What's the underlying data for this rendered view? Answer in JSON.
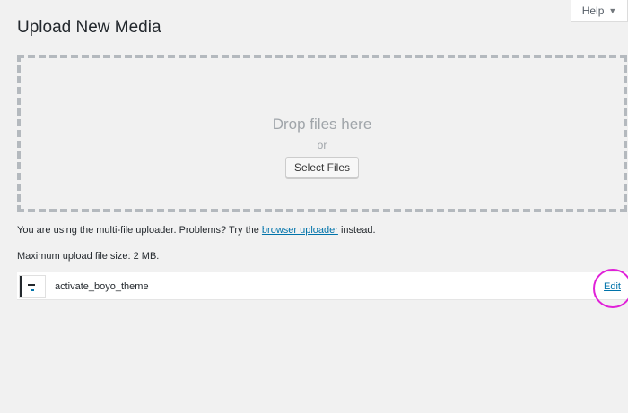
{
  "help_tab": {
    "label": "Help",
    "arrow": "▼"
  },
  "page": {
    "title": "Upload New Media"
  },
  "uploader": {
    "drop_text": "Drop files here",
    "or_text": "or",
    "select_files_label": "Select Files",
    "info_prefix": "You are using the multi-file uploader. Problems? Try the ",
    "browser_uploader_link": "browser uploader",
    "info_suffix": " instead.",
    "max_upload": "Maximum upload file size: 2 MB."
  },
  "media_items": [
    {
      "filename": "activate_boyo_theme",
      "edit_label": "Edit"
    }
  ],
  "annotation": {
    "highlight_color": "#e020d8"
  },
  "colors": {
    "background": "#f1f1f1",
    "link": "#0073aa",
    "dashed_border": "#b4b9be"
  }
}
